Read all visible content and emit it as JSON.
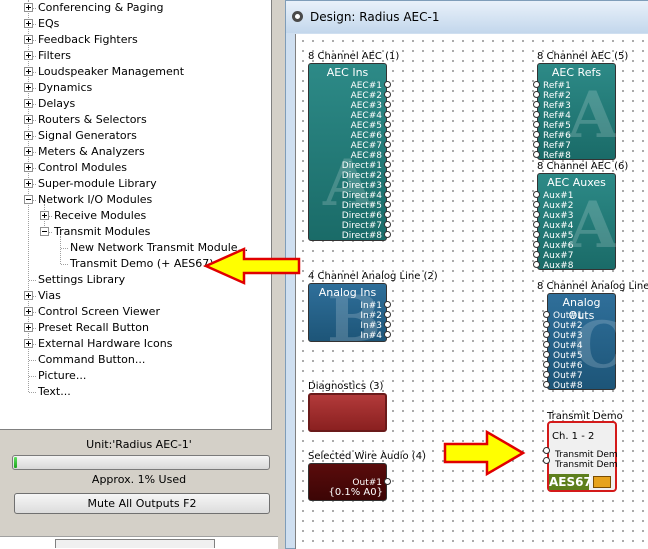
{
  "tree": {
    "items": [
      {
        "label": "Conferencing & Paging",
        "expander": "plus"
      },
      {
        "label": "EQs",
        "expander": "plus"
      },
      {
        "label": "Feedback Fighters",
        "expander": "plus"
      },
      {
        "label": "Filters",
        "expander": "plus"
      },
      {
        "label": "Loudspeaker Management",
        "expander": "plus"
      },
      {
        "label": "Dynamics",
        "expander": "plus"
      },
      {
        "label": "Delays",
        "expander": "plus"
      },
      {
        "label": "Routers & Selectors",
        "expander": "plus"
      },
      {
        "label": "Signal Generators",
        "expander": "plus"
      },
      {
        "label": "Meters & Analyzers",
        "expander": "plus"
      },
      {
        "label": "Control Modules",
        "expander": "plus"
      },
      {
        "label": "Super-module Library",
        "expander": "plus"
      },
      {
        "label": "Network I/O Modules",
        "expander": "minus"
      },
      {
        "label": "Receive Modules",
        "expander": "plus"
      },
      {
        "label": "Transmit Modules",
        "expander": "minus"
      },
      {
        "label": "New Network Transmit Module...",
        "expander": "none"
      },
      {
        "label": "Transmit Demo (+ AES67)",
        "expander": "none"
      },
      {
        "label": "Settings Library",
        "expander": "none"
      },
      {
        "label": "Vias",
        "expander": "plus"
      },
      {
        "label": "Control Screen Viewer",
        "expander": "plus"
      },
      {
        "label": "Preset Recall Button",
        "expander": "plus"
      },
      {
        "label": "External Hardware Icons",
        "expander": "plus"
      },
      {
        "label": "Command Button...",
        "expander": "none"
      },
      {
        "label": "Picture...",
        "expander": "none"
      },
      {
        "label": "Text...",
        "expander": "none"
      }
    ]
  },
  "status": {
    "unit_label": "Unit:'Radius AEC-1'",
    "usage_label": "Approx.  1% Used",
    "usage_fraction": 0.01,
    "mute_button_label": "Mute All Outputs  F2"
  },
  "design": {
    "title": "Design: Radius AEC-1",
    "blocks": {
      "aec_ins": {
        "title": "8 Channel AEC (1)",
        "header": "AEC Ins",
        "watermark": "A",
        "ports": [
          "AEC#1",
          "AEC#2",
          "AEC#3",
          "AEC#4",
          "AEC#5",
          "AEC#6",
          "AEC#7",
          "AEC#8",
          "Direct#1",
          "Direct#2",
          "Direct#3",
          "Direct#4",
          "Direct#5",
          "Direct#6",
          "Direct#7",
          "Direct#8"
        ]
      },
      "aec_refs": {
        "title": "8 Channel AEC (5)",
        "header": "AEC Refs",
        "watermark": "A",
        "ports": [
          "Ref#1",
          "Ref#2",
          "Ref#3",
          "Ref#4",
          "Ref#5",
          "Ref#6",
          "Ref#7",
          "Ref#8"
        ]
      },
      "aec_auxes": {
        "title": "8 Channel AEC (6)",
        "header": "AEC Auxes",
        "watermark": "A",
        "ports": [
          "Aux#1",
          "Aux#2",
          "Aux#3",
          "Aux#4",
          "Aux#5",
          "Aux#6",
          "Aux#7",
          "Aux#8"
        ]
      },
      "analog_ins": {
        "title": "4 Channel Analog Line (2)",
        "header": "Analog Ins",
        "watermark": "B",
        "ports": [
          "In#1",
          "In#2",
          "In#3",
          "In#4"
        ]
      },
      "analog_outs": {
        "title": "8 Channel Analog Line (n",
        "header": "Analog Outs",
        "watermark": "C",
        "ports": [
          "Out#1",
          "Out#2",
          "Out#3",
          "Out#4",
          "Out#5",
          "Out#6",
          "Out#7",
          "Out#8"
        ]
      },
      "diagnostics": {
        "title": "Diagnostics (3)"
      },
      "selected_wire": {
        "title": "Selected Wire Audio (4)",
        "ports": [
          "Out#1"
        ],
        "value": "{0.1% A0}"
      },
      "transmit_demo": {
        "title": "Transmit Demo",
        "channels": "Ch. 1 - 2",
        "ports": [
          "Transmit Dem",
          "Transmit Dem"
        ],
        "badge": "AES67"
      }
    }
  },
  "colors": {
    "arrow_fill": "#ffff00",
    "arrow_stroke": "#e00000",
    "teal_block": "#1f7a77",
    "blue_block": "#25628a"
  }
}
